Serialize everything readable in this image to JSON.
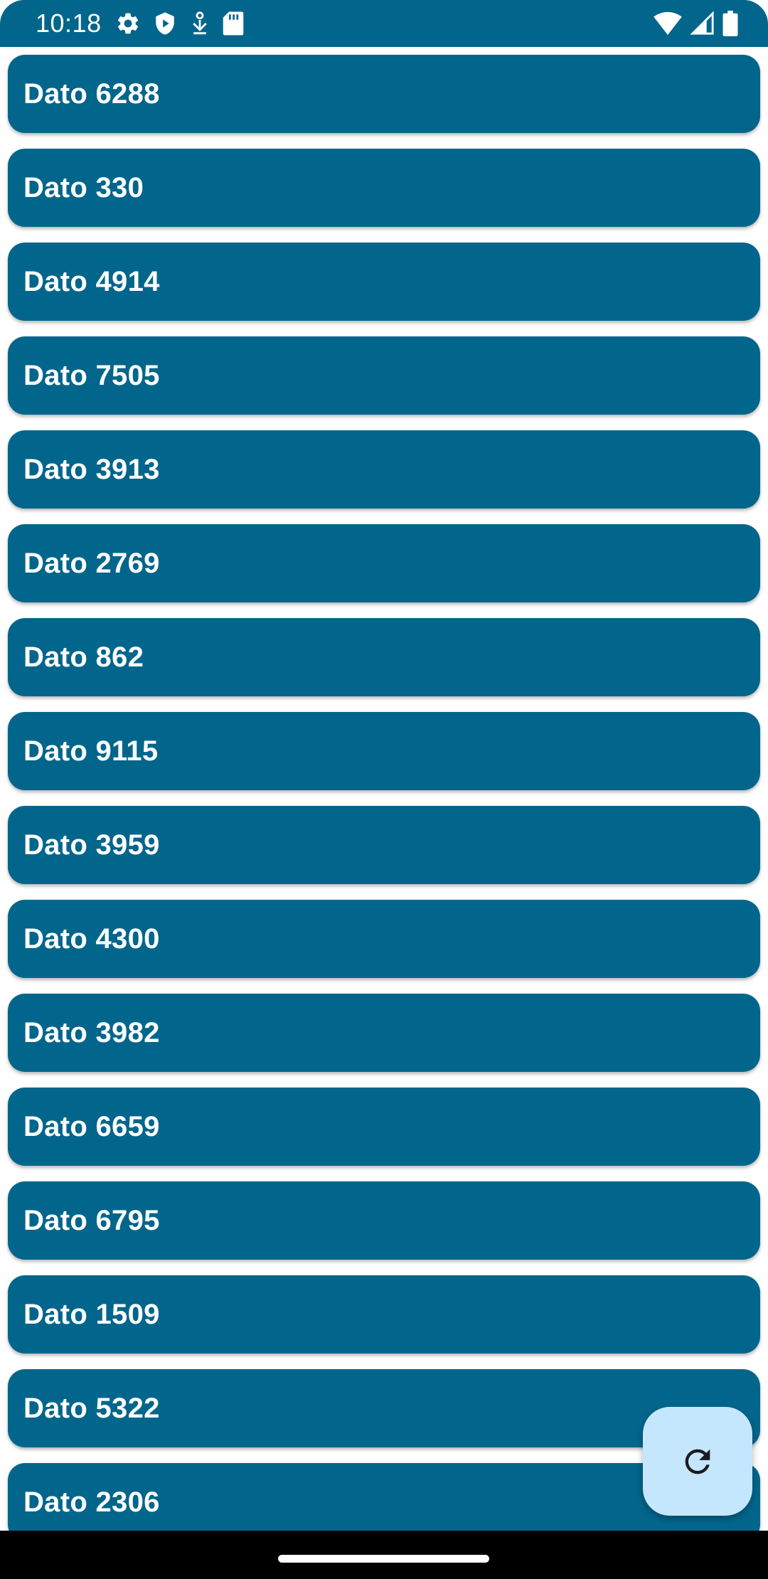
{
  "status_bar": {
    "time": "10:18",
    "left_icons": [
      "gear-icon",
      "shield-play-icon",
      "download-icon",
      "sd-card-icon"
    ],
    "right_icons": [
      "wifi-icon",
      "cell-signal-icon",
      "battery-icon"
    ],
    "background_color": "#02668c"
  },
  "list": {
    "item_color": "#02668c",
    "items": [
      {
        "label": "Dato 6288"
      },
      {
        "label": "Dato 330"
      },
      {
        "label": "Dato 4914"
      },
      {
        "label": "Dato 7505"
      },
      {
        "label": "Dato 3913"
      },
      {
        "label": "Dato 2769"
      },
      {
        "label": "Dato 862"
      },
      {
        "label": "Dato 9115"
      },
      {
        "label": "Dato 3959"
      },
      {
        "label": "Dato 4300"
      },
      {
        "label": "Dato 3982"
      },
      {
        "label": "Dato 6659"
      },
      {
        "label": "Dato 6795"
      },
      {
        "label": "Dato 1509"
      },
      {
        "label": "Dato 5322"
      },
      {
        "label": "Dato 2306"
      }
    ]
  },
  "fab": {
    "icon": "refresh-icon",
    "background_color": "#c4e7fd"
  }
}
